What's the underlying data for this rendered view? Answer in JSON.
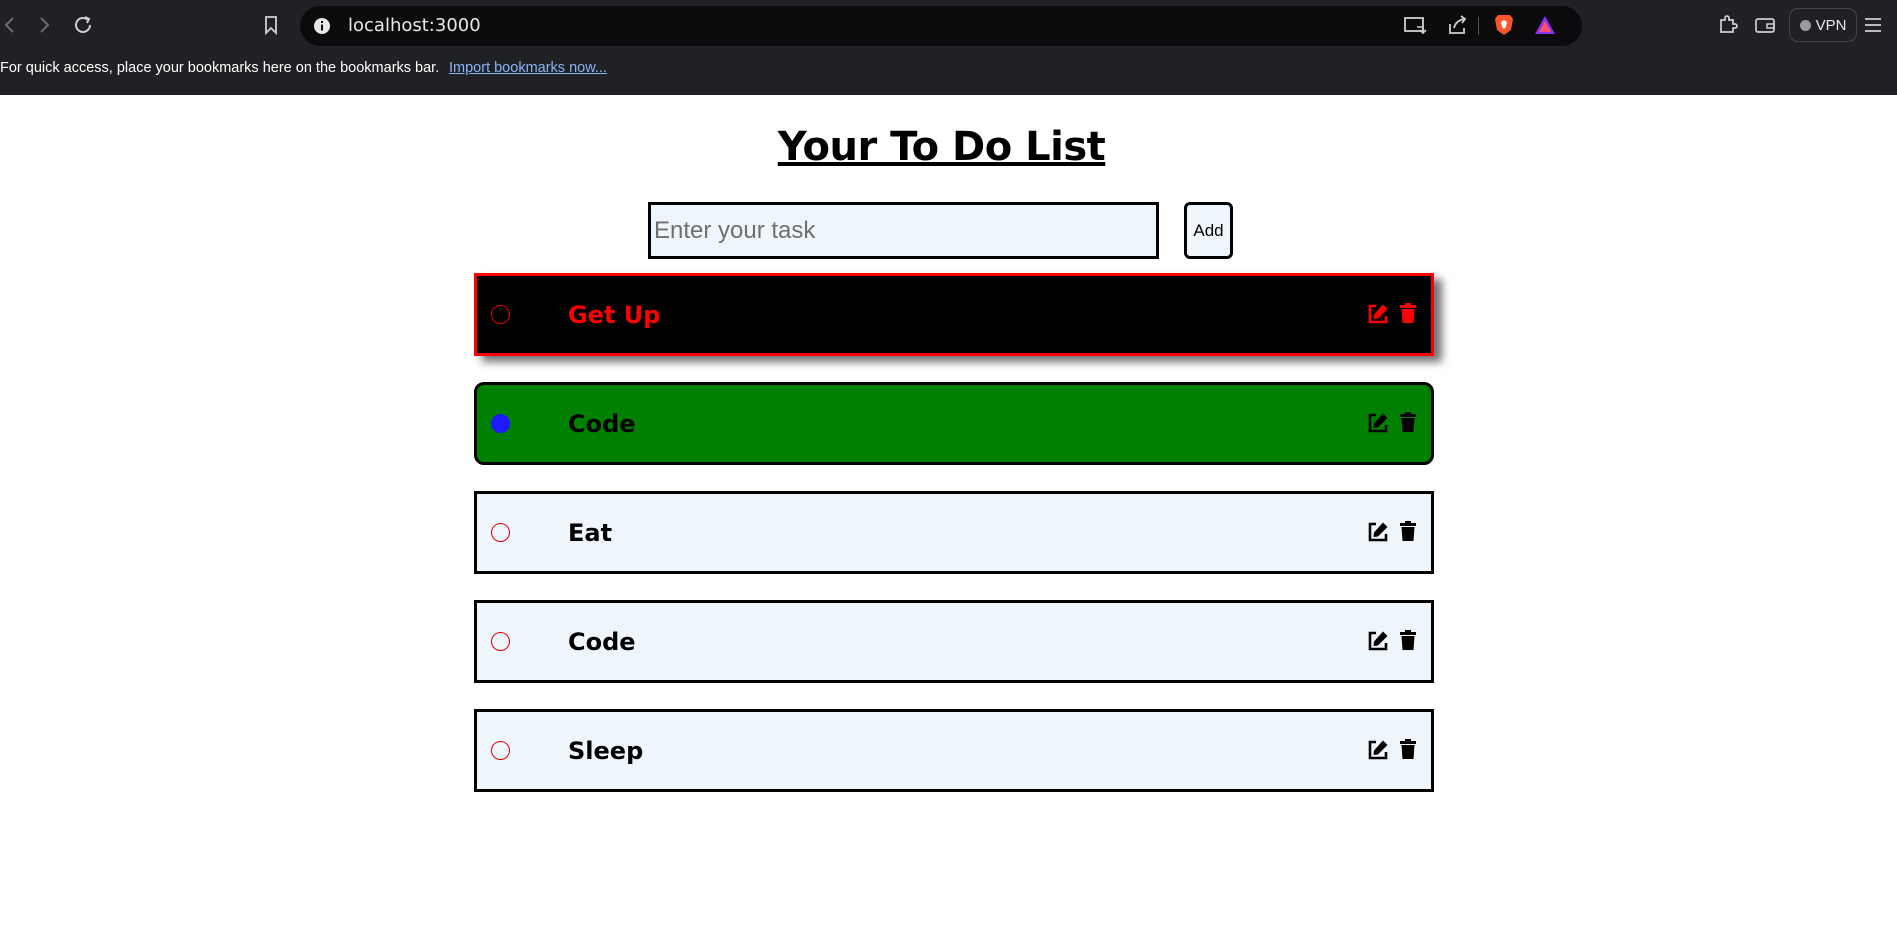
{
  "browser": {
    "url": "localhost:3000",
    "vpn_label": "VPN",
    "bookmarks_prompt": "For quick access, place your bookmarks here on the bookmarks bar.",
    "import_link": "Import bookmarks now..."
  },
  "app": {
    "title": "Your To Do List",
    "input_placeholder": "Enter your task",
    "input_value": "",
    "add_label": "Add"
  },
  "tasks": [
    {
      "text": "Get Up",
      "style": "black",
      "completed": false
    },
    {
      "text": "Code",
      "style": "green",
      "completed": true
    },
    {
      "text": "Eat",
      "style": "light",
      "completed": false
    },
    {
      "text": "Code",
      "style": "light",
      "completed": false
    },
    {
      "text": "Sleep",
      "style": "light",
      "completed": false
    }
  ],
  "colors": {
    "chrome_bg": "#202124",
    "task_light_bg": "#eef6fc",
    "highlight_red": "#ff0000",
    "done_green": "#008000",
    "done_radio_blue": "#1e19ff"
  },
  "icons": {
    "edit": "edit-icon",
    "delete": "trash-icon"
  }
}
